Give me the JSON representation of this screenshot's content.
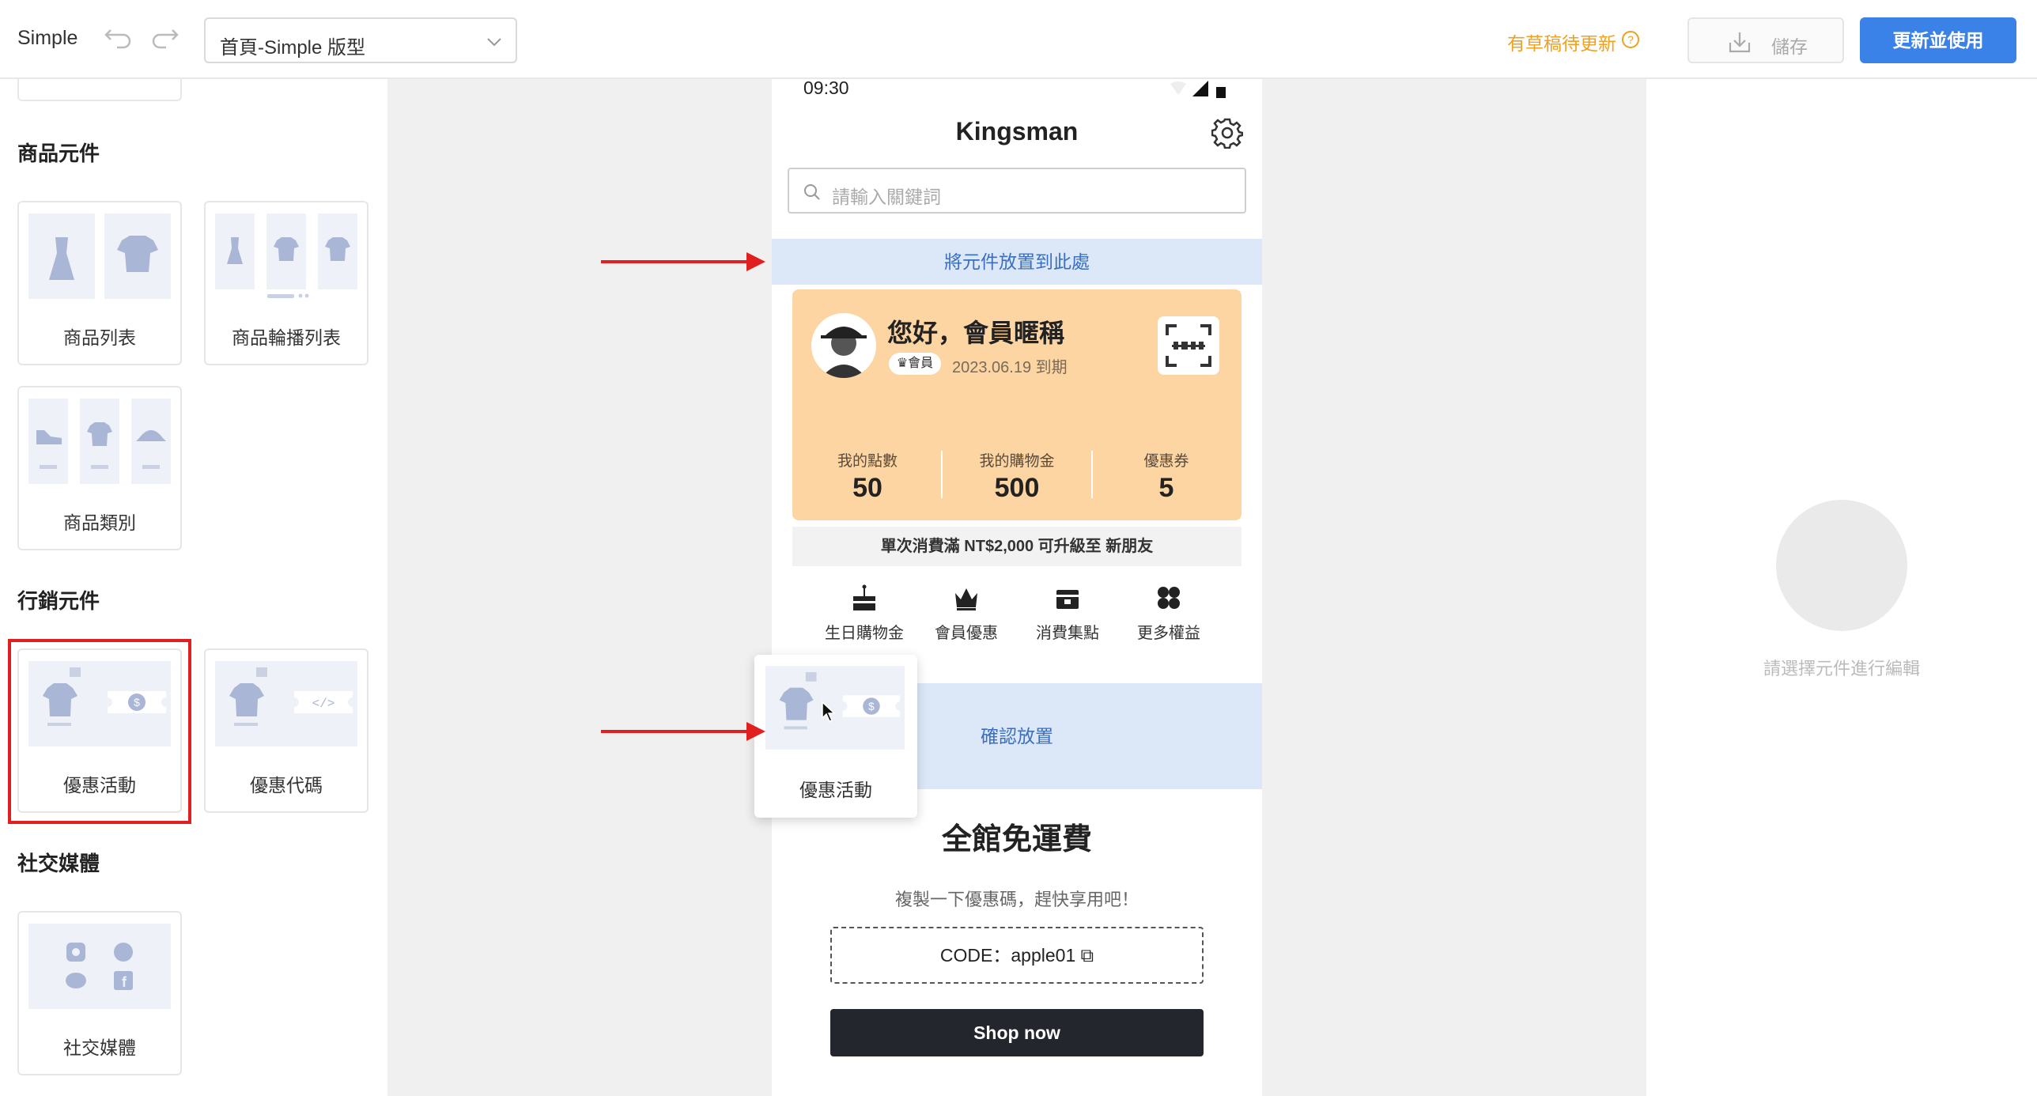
{
  "header": {
    "app_name": "Simple",
    "template_select": "首頁-Simple 版型",
    "draft_notice": "有草稿待更新",
    "save_label": "儲存",
    "update_label": "更新並使用"
  },
  "sidebar": {
    "sections": [
      {
        "title": "商品元件",
        "items": [
          "商品列表",
          "商品輪播列表",
          "商品類別"
        ]
      },
      {
        "title": "行銷元件",
        "items": [
          "優惠活動",
          "優惠代碼"
        ]
      },
      {
        "title": "社交媒體",
        "items": [
          "社交媒體"
        ]
      }
    ]
  },
  "phone": {
    "time": "09:30",
    "store_title": "Kingsman",
    "search_placeholder": "請輸入關鍵詞",
    "drop_hint_top": "將元件放置到此處",
    "member": {
      "greeting": "您好，會員暱稱",
      "badge": "會員",
      "expiry": "2023.06.19 到期",
      "stats": [
        {
          "label": "我的點數",
          "value": "50"
        },
        {
          "label": "我的購物金",
          "value": "500"
        },
        {
          "label": "優惠券",
          "value": "5"
        }
      ],
      "upgrade_text": "單次消費滿 NT$2,000 可升級至 新朋友",
      "benefits": [
        "生日購物金",
        "會員優惠",
        "消費集點",
        "更多權益"
      ]
    },
    "drop_confirm": "確認放置",
    "promo": {
      "title": "全館免運費",
      "subtitle": "複製一下優惠碼，趕快享用吧！",
      "code": "CODE：apple01",
      "button": "Shop now"
    }
  },
  "drag_ghost_label": "優惠活動",
  "right_panel": {
    "placeholder": "請選擇元件進行編輯"
  },
  "colors": {
    "primary": "#3b82e8",
    "warning": "#f0a020",
    "member_card": "#fdd5a3",
    "drop_zone": "#dce8f8",
    "highlight": "#e02020"
  }
}
